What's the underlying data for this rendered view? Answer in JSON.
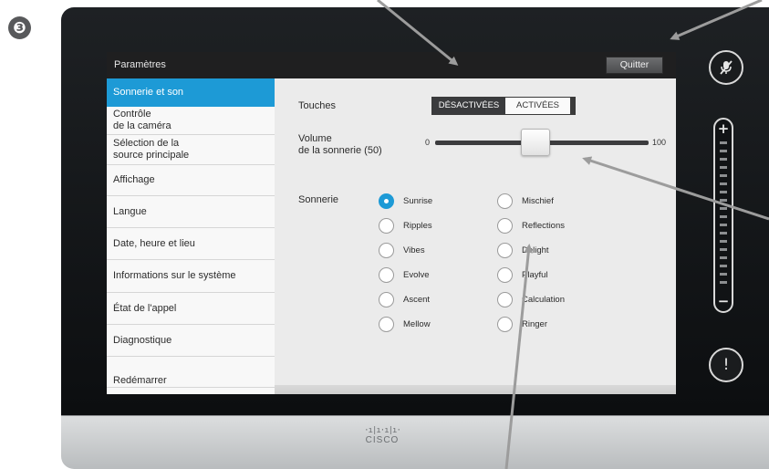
{
  "step_number": "❸",
  "brand": {
    "bars": "·ı|ı·ı|ı·",
    "word": "CISCO"
  },
  "titlebar": {
    "title": "Paramètres",
    "quit_label": "Quitter"
  },
  "sidebar": {
    "items": [
      {
        "label": "Sonnerie et son",
        "active": true
      },
      {
        "label": "Contrôle\nde la caméra"
      },
      {
        "label": "Sélection de la\nsource principale"
      },
      {
        "label": "Affichage"
      },
      {
        "label": "Langue"
      },
      {
        "label": "Date, heure et lieu"
      },
      {
        "label": "Informations sur le système"
      },
      {
        "label": "État de l'appel"
      },
      {
        "label": "Diagnostique"
      },
      {
        "label": "Redémarrer"
      }
    ]
  },
  "settings": {
    "keys": {
      "label": "Touches",
      "off_label": "DÉSACTIVÉES",
      "on_label": "ACTIVÉES",
      "selected": "DÉSACTIVÉES"
    },
    "volume": {
      "label": "Volume\nde la sonnerie (50)",
      "min_label": "0",
      "max_label": "100",
      "value": 50
    },
    "ringtone": {
      "label": "Sonnerie",
      "selected": "Sunrise",
      "options": [
        "Sunrise",
        "Mischief",
        "Ripples",
        "Reflections",
        "Vibes",
        "Delight",
        "Evolve",
        "Playful",
        "Ascent",
        "Calculation",
        "Mellow",
        "Ringer"
      ]
    }
  },
  "side_controls": {
    "mute_icon": "microphone-muted-icon",
    "volume_plus": "+",
    "volume_minus": "−",
    "alert_icon": "!"
  },
  "colors": {
    "accent": "#1d9ad6",
    "bezel": "#1a1c1e",
    "titlebar": "#1f1f20",
    "arrow": "#9c9c9c"
  }
}
